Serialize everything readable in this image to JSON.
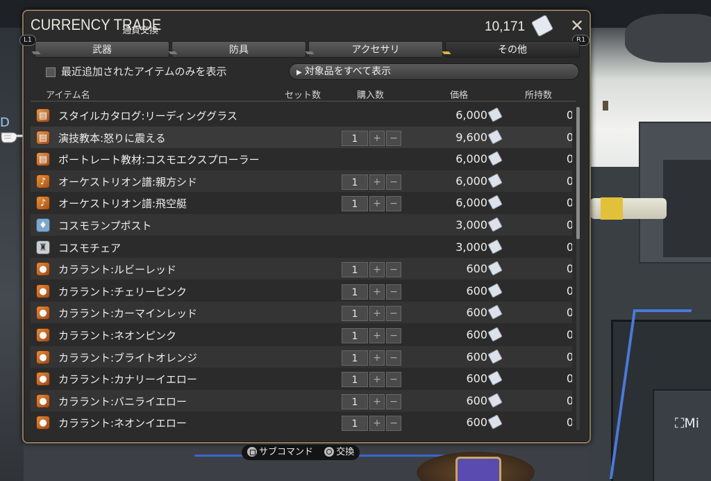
{
  "window": {
    "title": "CURRENCY TRADE",
    "subtitle": "通貨交換",
    "currency_amount": "10,171",
    "currency_icon": "scrip-ticket-icon",
    "left_shoulder": "L1",
    "right_shoulder": "R1"
  },
  "tabs": [
    {
      "label": "武器",
      "active": false
    },
    {
      "label": "防具",
      "active": false
    },
    {
      "label": "アクセサリ",
      "active": false
    },
    {
      "label": "その他",
      "active": true
    }
  ],
  "filter": {
    "checkbox_label": "最近追加されたアイテムのみを表示",
    "checked": false,
    "show_all_label": "対象品をすべて表示"
  },
  "columns": {
    "item": "アイテム名",
    "set_count": "セット数",
    "purchase_qty": "購入数",
    "price": "価格",
    "owned": "所持数"
  },
  "items": [
    {
      "name": "スタイルカタログ:リーディンググラス",
      "icon": "catalog-box-icon",
      "qty": "",
      "price": "6,000",
      "owned": "0"
    },
    {
      "name": "演技教本:怒りに震える",
      "icon": "catalog-box-icon",
      "qty": "1",
      "price": "9,600",
      "owned": "0"
    },
    {
      "name": "ポートレート教材:コスモエクスプローラー",
      "icon": "catalog-box-icon",
      "qty": "",
      "price": "6,000",
      "owned": "0"
    },
    {
      "name": "オーケストリオン譜:親方シド",
      "icon": "music-note-icon",
      "qty": "1",
      "price": "6,000",
      "owned": "0"
    },
    {
      "name": "オーケストリオン譜:飛空艇",
      "icon": "music-note-icon",
      "qty": "1",
      "price": "6,000",
      "owned": "0"
    },
    {
      "name": "コスモランプポスト",
      "icon": "lamp-icon",
      "qty": "",
      "price": "3,000",
      "owned": "0"
    },
    {
      "name": "コスモチェア",
      "icon": "chair-icon",
      "qty": "",
      "price": "3,000",
      "owned": "0"
    },
    {
      "name": "カララント:ルビーレッド",
      "icon": "dye-pot-icon",
      "qty": "1",
      "price": "600",
      "owned": "0"
    },
    {
      "name": "カララント:チェリーピンク",
      "icon": "dye-pot-icon",
      "qty": "1",
      "price": "600",
      "owned": "0"
    },
    {
      "name": "カララント:カーマインレッド",
      "icon": "dye-pot-icon",
      "qty": "1",
      "price": "600",
      "owned": "0"
    },
    {
      "name": "カララント:ネオンピンク",
      "icon": "dye-pot-icon",
      "qty": "1",
      "price": "600",
      "owned": "0"
    },
    {
      "name": "カララント:ブライトオレンジ",
      "icon": "dye-pot-icon",
      "qty": "1",
      "price": "600",
      "owned": "0"
    },
    {
      "name": "カララント:カナリーイエロー",
      "icon": "dye-pot-icon",
      "qty": "1",
      "price": "600",
      "owned": "0"
    },
    {
      "name": "カララント:バニライエロー",
      "icon": "dye-pot-icon",
      "qty": "1",
      "price": "600",
      "owned": "0"
    },
    {
      "name": "カララント:ネオンイエロー",
      "icon": "dye-pot-icon",
      "qty": "1",
      "price": "600",
      "owned": "0"
    }
  ],
  "selected_index": 1,
  "hints": {
    "subcommand": "サブコマンド",
    "exchange": "交換"
  },
  "background": {
    "left_text": "D",
    "right_text": "Mi"
  },
  "colors": {
    "frame_gold": "#8e7c5e",
    "panel_bg": "#2b2b2b",
    "active_tab_marker": "#d5b545"
  }
}
